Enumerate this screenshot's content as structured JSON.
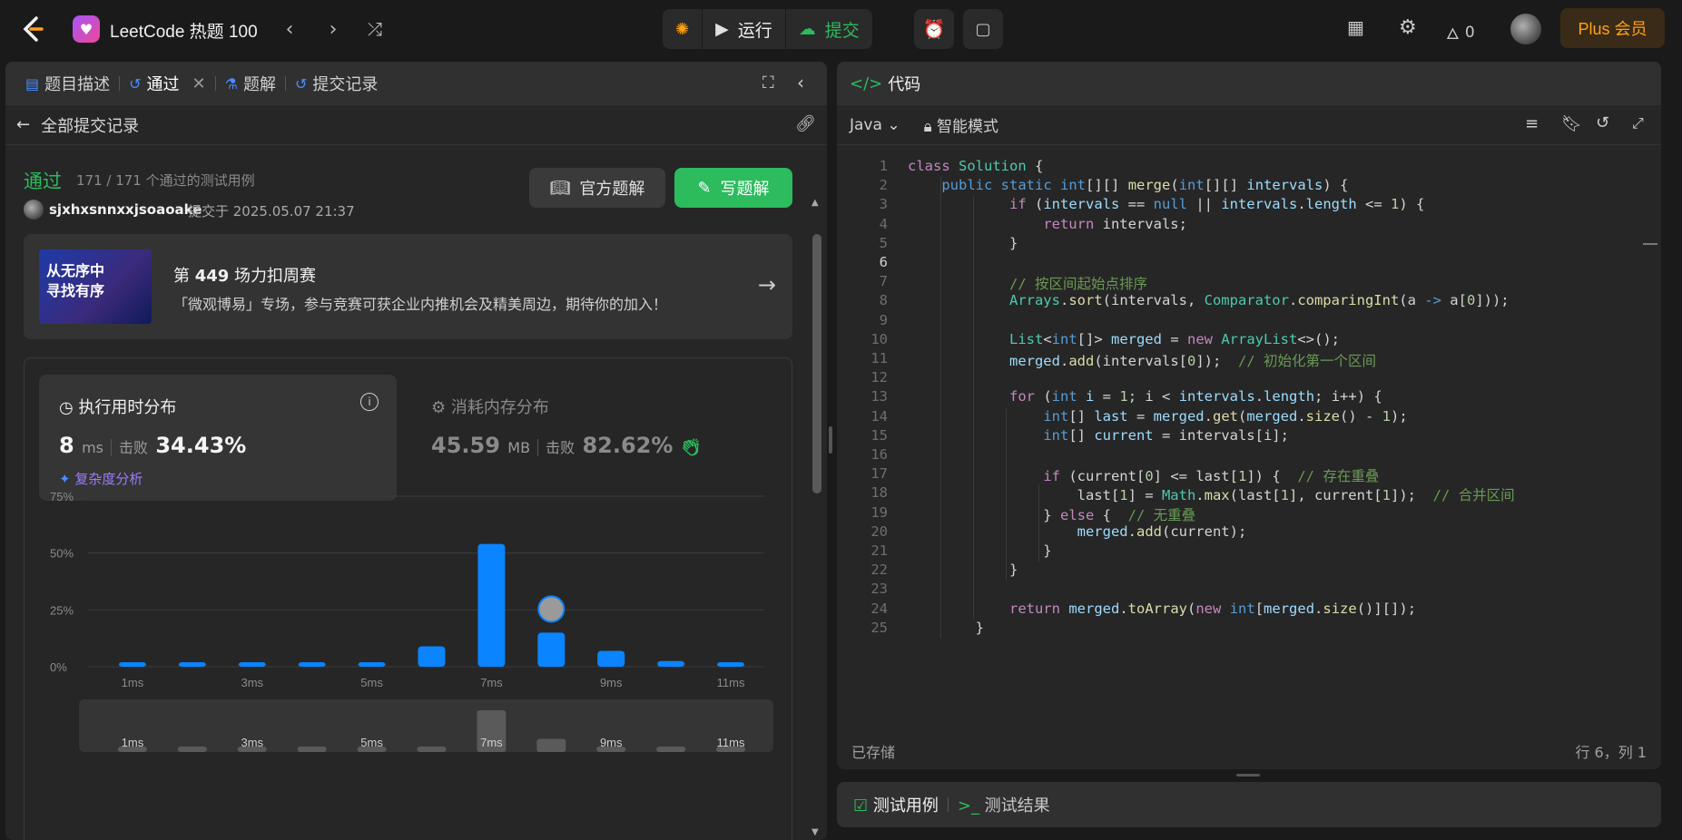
{
  "topbar": {
    "problem_title": "LeetCode 热题 100",
    "run_label": "运行",
    "submit_label": "提交",
    "streak_count": "0",
    "plus_label": "Plus 会员"
  },
  "left_tabs": {
    "description": "题目描述",
    "accepted": "通过",
    "solutions": "题解",
    "submissions": "提交记录"
  },
  "subbar": {
    "back_label": "全部提交记录"
  },
  "result": {
    "status": "通过",
    "testcases": "171 / 171 个通过的测试用例",
    "username": "sjxhxsnnxxjsoaoake",
    "submitted_at": "提交于 2025.05.07 21:37",
    "official_solution_label": "官方题解",
    "write_solution_label": "写题解"
  },
  "contest": {
    "image_line1": "从无序中",
    "image_line2": "寻找有序",
    "title_prefix": "第 ",
    "title_number": "449",
    "title_suffix": " 场力扣周赛",
    "description": "「微观博易」专场，参与竞赛可获企业内推机会及精美周边，期待你的加入！"
  },
  "runtime": {
    "title": "执行用时分布",
    "value": "8",
    "unit": "ms",
    "beats_label": "击败",
    "beats_value": "34.43%",
    "complexity_label": "复杂度分析"
  },
  "memory": {
    "title": "消耗内存分布",
    "value": "45.59",
    "unit": "MB",
    "beats_label": "击败",
    "beats_value": "82.62%"
  },
  "chart_data": {
    "type": "bar",
    "title": "",
    "xlabel": "",
    "ylabel": "",
    "y_tick_labels": [
      "75%",
      "50%",
      "25%",
      "0%"
    ],
    "ylim": [
      0,
      75
    ],
    "x_tick_labels": [
      "1ms",
      "3ms",
      "5ms",
      "7ms",
      "9ms",
      "11ms"
    ],
    "categories": [
      "1ms",
      "2ms",
      "3ms",
      "4ms",
      "5ms",
      "6ms",
      "7ms",
      "8ms",
      "9ms",
      "10ms",
      "11ms"
    ],
    "values": [
      2,
      2,
      2,
      2,
      2,
      9,
      54,
      15,
      7,
      2.5,
      2
    ],
    "highlight_category": "8ms",
    "grid": true,
    "colors": {
      "bar": "#0a84ff",
      "grid": "#3c3c3c"
    },
    "overview_values": [
      0.5,
      0.5,
      0.5,
      0.5,
      0.5,
      0.5,
      38,
      12,
      0.5,
      0.5,
      0.5
    ]
  },
  "code_header": {
    "title": "代码",
    "language": "Java",
    "mode": "智能模式"
  },
  "code_lines": [
    [
      [
        "kw",
        "class"
      ],
      [
        "pl",
        " "
      ],
      [
        "ty",
        "Solution"
      ],
      [
        "pl",
        " {"
      ]
    ],
    [
      [
        "pl",
        "    "
      ],
      [
        "kb",
        "public"
      ],
      [
        "pl",
        " "
      ],
      [
        "kb",
        "static"
      ],
      [
        "pl",
        " "
      ],
      [
        "kb",
        "int"
      ],
      [
        "pl",
        "[][] "
      ],
      [
        "fn",
        "merge"
      ],
      [
        "pl",
        "("
      ],
      [
        "kb",
        "int"
      ],
      [
        "pl",
        "[][] "
      ],
      [
        "vr",
        "intervals"
      ],
      [
        "pl",
        ") {"
      ]
    ],
    [
      [
        "pl",
        "            "
      ],
      [
        "kw",
        "if"
      ],
      [
        "pl",
        " ("
      ],
      [
        "vr",
        "intervals"
      ],
      [
        "pl",
        " == "
      ],
      [
        "kb",
        "null"
      ],
      [
        "pl",
        " || "
      ],
      [
        "vr",
        "intervals"
      ],
      [
        "pl",
        "."
      ],
      [
        "vr",
        "length"
      ],
      [
        "pl",
        " <= "
      ],
      [
        "nm",
        "1"
      ],
      [
        "pl",
        ") {"
      ]
    ],
    [
      [
        "pl",
        "                "
      ],
      [
        "kw",
        "return"
      ],
      [
        "pl",
        " intervals;"
      ]
    ],
    [
      [
        "pl",
        "            }"
      ]
    ],
    [
      [
        "pl",
        ""
      ]
    ],
    [
      [
        "pl",
        "            "
      ],
      [
        "cm",
        "// 按区间起始点排序"
      ]
    ],
    [
      [
        "pl",
        "            "
      ],
      [
        "ty",
        "Arrays"
      ],
      [
        "pl",
        "."
      ],
      [
        "fn",
        "sort"
      ],
      [
        "pl",
        "(intervals, "
      ],
      [
        "ty",
        "Comparator"
      ],
      [
        "pl",
        "."
      ],
      [
        "fn",
        "comparingInt"
      ],
      [
        "pl",
        "(a "
      ],
      [
        "kb",
        "->"
      ],
      [
        "pl",
        " a["
      ],
      [
        "nm",
        "0"
      ],
      [
        "pl",
        "]));"
      ]
    ],
    [
      [
        "pl",
        ""
      ]
    ],
    [
      [
        "pl",
        "            "
      ],
      [
        "ty",
        "List"
      ],
      [
        "pl",
        "<"
      ],
      [
        "kb",
        "int"
      ],
      [
        "pl",
        "[]> "
      ],
      [
        "vr",
        "merged"
      ],
      [
        "pl",
        " = "
      ],
      [
        "kw",
        "new"
      ],
      [
        "pl",
        " "
      ],
      [
        "ty",
        "ArrayList"
      ],
      [
        "pl",
        "<>();"
      ]
    ],
    [
      [
        "pl",
        "            "
      ],
      [
        "vr",
        "merged"
      ],
      [
        "pl",
        "."
      ],
      [
        "fn",
        "add"
      ],
      [
        "pl",
        "(intervals["
      ],
      [
        "nm",
        "0"
      ],
      [
        "pl",
        "]);  "
      ],
      [
        "cm",
        "// 初始化第一个区间"
      ]
    ],
    [
      [
        "pl",
        ""
      ]
    ],
    [
      [
        "pl",
        "            "
      ],
      [
        "kw",
        "for"
      ],
      [
        "pl",
        " ("
      ],
      [
        "kb",
        "int"
      ],
      [
        "pl",
        " "
      ],
      [
        "vr",
        "i"
      ],
      [
        "pl",
        " = "
      ],
      [
        "nm",
        "1"
      ],
      [
        "pl",
        "; i < "
      ],
      [
        "vr",
        "intervals"
      ],
      [
        "pl",
        "."
      ],
      [
        "vr",
        "length"
      ],
      [
        "pl",
        "; i++) {"
      ]
    ],
    [
      [
        "pl",
        "                "
      ],
      [
        "kb",
        "int"
      ],
      [
        "pl",
        "[] "
      ],
      [
        "vr",
        "last"
      ],
      [
        "pl",
        " = "
      ],
      [
        "vr",
        "merged"
      ],
      [
        "pl",
        "."
      ],
      [
        "fn",
        "get"
      ],
      [
        "pl",
        "("
      ],
      [
        "vr",
        "merged"
      ],
      [
        "pl",
        "."
      ],
      [
        "fn",
        "size"
      ],
      [
        "pl",
        "() - "
      ],
      [
        "nm",
        "1"
      ],
      [
        "pl",
        ");"
      ]
    ],
    [
      [
        "pl",
        "                "
      ],
      [
        "kb",
        "int"
      ],
      [
        "pl",
        "[] "
      ],
      [
        "vr",
        "current"
      ],
      [
        "pl",
        " = intervals[i];"
      ]
    ],
    [
      [
        "pl",
        ""
      ]
    ],
    [
      [
        "pl",
        "                "
      ],
      [
        "kw",
        "if"
      ],
      [
        "pl",
        " (current["
      ],
      [
        "nm",
        "0"
      ],
      [
        "pl",
        "] <= last["
      ],
      [
        "nm",
        "1"
      ],
      [
        "pl",
        "]) {  "
      ],
      [
        "cm",
        "// 存在重叠"
      ]
    ],
    [
      [
        "pl",
        "                    last["
      ],
      [
        "nm",
        "1"
      ],
      [
        "pl",
        "] = "
      ],
      [
        "ty",
        "Math"
      ],
      [
        "pl",
        "."
      ],
      [
        "fn",
        "max"
      ],
      [
        "pl",
        "(last["
      ],
      [
        "nm",
        "1"
      ],
      [
        "pl",
        "], current["
      ],
      [
        "nm",
        "1"
      ],
      [
        "pl",
        "]);  "
      ],
      [
        "cm",
        "// 合并区间"
      ]
    ],
    [
      [
        "pl",
        "                } "
      ],
      [
        "kw",
        "else"
      ],
      [
        "pl",
        " {  "
      ],
      [
        "cm",
        "// 无重叠"
      ]
    ],
    [
      [
        "pl",
        "                    "
      ],
      [
        "vr",
        "merged"
      ],
      [
        "pl",
        "."
      ],
      [
        "fn",
        "add"
      ],
      [
        "pl",
        "(current);"
      ]
    ],
    [
      [
        "pl",
        "                }"
      ]
    ],
    [
      [
        "pl",
        "            }"
      ]
    ],
    [
      [
        "pl",
        ""
      ]
    ],
    [
      [
        "pl",
        "            "
      ],
      [
        "kw",
        "return"
      ],
      [
        "pl",
        " "
      ],
      [
        "vr",
        "merged"
      ],
      [
        "pl",
        "."
      ],
      [
        "fn",
        "toArray"
      ],
      [
        "pl",
        "("
      ],
      [
        "kw",
        "new"
      ],
      [
        "pl",
        " "
      ],
      [
        "kb",
        "int"
      ],
      [
        "pl",
        "["
      ],
      [
        "vr",
        "merged"
      ],
      [
        "pl",
        "."
      ],
      [
        "fn",
        "size"
      ],
      [
        "pl",
        "()][]);"
      ]
    ],
    [
      [
        "pl",
        "        }"
      ]
    ]
  ],
  "code_status": {
    "saved": "已存储",
    "cursor": "行 6，列 1"
  },
  "bottom_tabs": {
    "testcase": "测试用例",
    "result": "测试结果"
  }
}
